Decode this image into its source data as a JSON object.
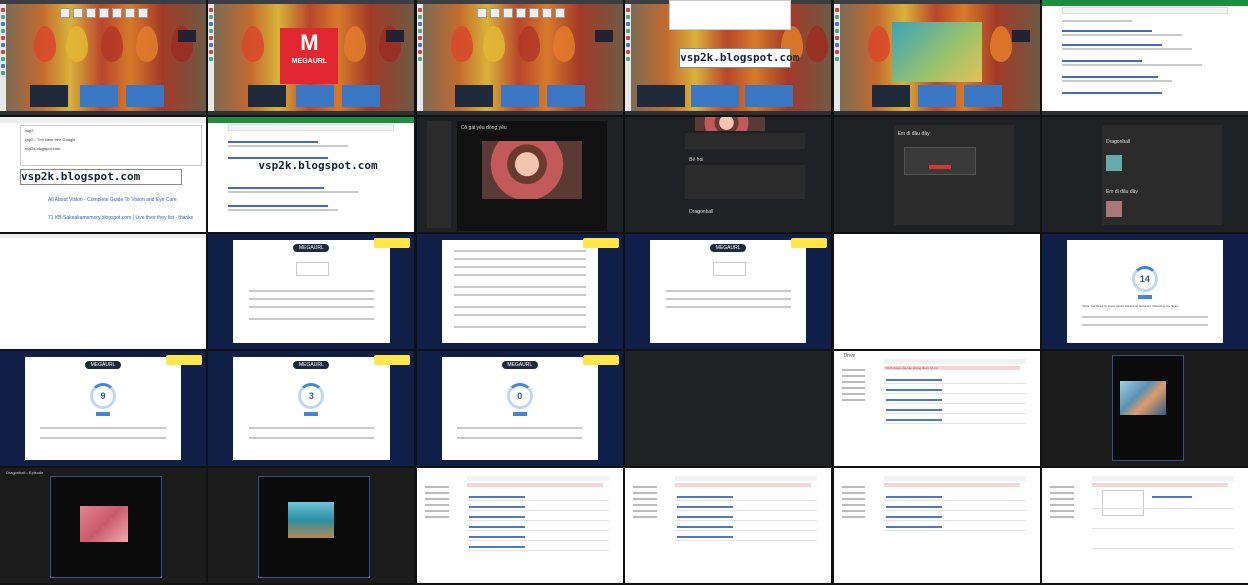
{
  "overlay_captions": {
    "blog1": "vsp2k.blogspot.com",
    "blog2": "vsp2k.blogspot.com",
    "blog3": "vsp2k.blogspot.com"
  },
  "promo": {
    "brand_letter": "M",
    "brand_name": "MEGAURL"
  },
  "search": {
    "query": "vsp2",
    "suggestion_1": "vsp2 - Tìm kiếm trên Google",
    "suggestion_2": "vsp2k.blogspot.com"
  },
  "results": {
    "title_1": "All About Vision - Complete Guide To Vision and Eye Care",
    "title_2": "71 KB Sakeakamemory.blogspot.com | Live their they list - thanks"
  },
  "dark_app": {
    "modal_title": "Cô gái yêu đồng yêu",
    "section_1": "Bé hoi",
    "section_2": "Dragonball",
    "section_3": "Em đi đâu đây",
    "section_4": "Em đi đâu đây",
    "section_5": "Dragonball"
  },
  "shortener": {
    "logo_text": "MEGAURL",
    "countdown_1": "14",
    "countdown_2": "9",
    "countdown_3": "3",
    "countdown_4": "0",
    "question": "What You Need To Know About Harassing Behavior: Detecting the Signs"
  },
  "drive": {
    "title": "Drive",
    "warning": "Trình duyệt của bạn không được hỗ trợ"
  },
  "player": {
    "title": "Dragonball - Episode"
  }
}
